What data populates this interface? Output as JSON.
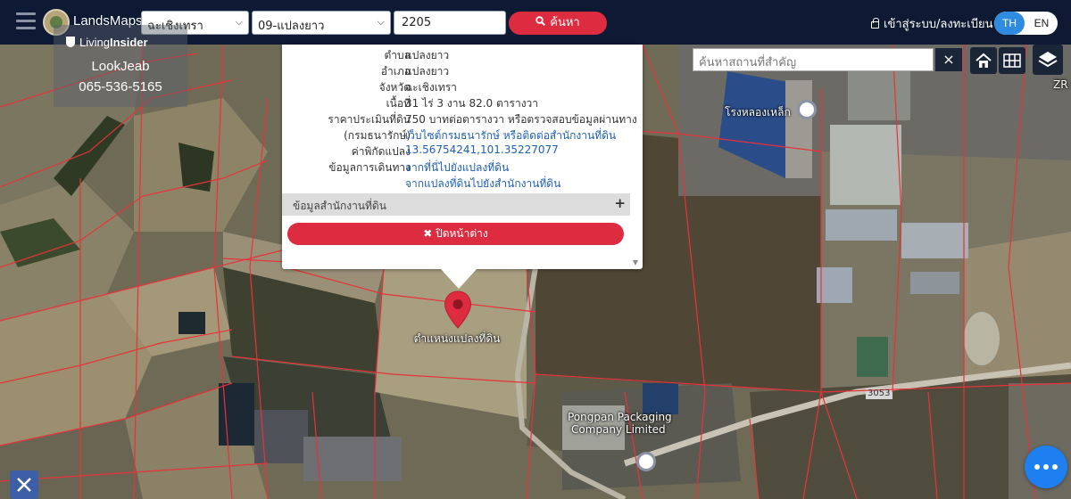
{
  "app": {
    "title": "LandsMaps"
  },
  "search": {
    "province": "ฉะเชิงเทรา",
    "search_type": "09-แปลงยาว",
    "parcel_number": "2205",
    "button_label": "ค้นหา"
  },
  "header": {
    "login_label": "เข้าสู่ระบบ/ลงทะเบียน",
    "lang_th": "TH",
    "lang_en": "EN",
    "active_lang": "TH"
  },
  "watermark": {
    "brand_prefix": "Living",
    "brand_bold": "Insider",
    "name": "LookJeab",
    "phone": "065-536-5165"
  },
  "popup": {
    "rows": [
      {
        "label": "ตำบล",
        "value": "แปลงยาว"
      },
      {
        "label": "อำเภอ",
        "value": "แปลงยาว"
      },
      {
        "label": "จังหวัด",
        "value": "ฉะเชิงเทรา"
      },
      {
        "label": "เนื้อที่",
        "value": "31 ไร่ 3 งาน 82.0 ตารางวา"
      },
      {
        "label": "ราคาประเมินที่ดิน",
        "value": "750 บาทต่อตารางวา หรือตรวจสอบข้อมูลผ่านทาง"
      },
      {
        "label": "(กรมธนารักษ์)",
        "value": "เว็บไซต์กรมธนารักษ์ หรือติดต่อสำนักงานที่ดิน"
      },
      {
        "label": "ค่าพิกัดแปลง",
        "value": "13.56754241,101.35227077"
      },
      {
        "label": "ข้อมูลการเดินทาง",
        "value": "จากที่นี่ไปยังแปลงที่ดิน"
      },
      {
        "label": "",
        "value": "จากแปลงที่ดินไปยังสำนักงานที่ดิน"
      }
    ],
    "office_label": "ข้อมูลสำนักงานที่ดิน",
    "close_label": "ปิดหน้าต่าง"
  },
  "map": {
    "pin_label": "ตำแหน่งแปลงที่ดิน",
    "place_search_placeholder": "ค้นหาสถานที่สำคัญ",
    "places": {
      "steel_factory": "โรงหลองเหล็ก",
      "packaging_line1": "Pongpan Packaging",
      "packaging_line2": "Company Limited",
      "road": "3053",
      "zr": "ZR Inter"
    }
  },
  "colors": {
    "navbar": "#0e1a33",
    "accent_red": "#dd2c3f",
    "accent_blue": "#2e8be0",
    "parcel_line": "#e8323a"
  }
}
